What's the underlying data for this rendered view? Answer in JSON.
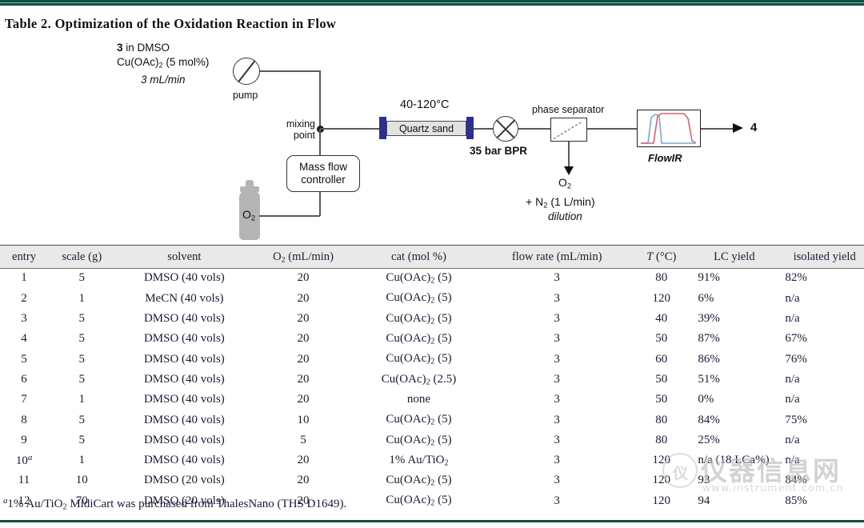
{
  "page": {
    "title": "Table 2. Optimization of the Oxidation Reaction in Flow",
    "accent_color": "#0b4f3f",
    "footnote": "1% Au/TiO2 MidiCart was purchased from ThalesNano (THS D1649).",
    "footnote_marker": "a"
  },
  "scheme": {
    "feed_line1_bold": "3",
    "feed_line1_rest": " in DMSO",
    "feed_line2": "Cu(OAc)2 (5 mol%)",
    "feed_flow": "3 mL/min",
    "pump_label": "pump",
    "mixing_point_label_1": "mixing",
    "mixing_point_label_2": "point",
    "mfc_line1": "Mass flow",
    "mfc_line2": "controller",
    "cylinder_label": "O2",
    "reactor_temp": "40-120°C",
    "reactor_label": "Quartz sand",
    "bpr_label": "35 bar BPR",
    "separator_label": "phase separator",
    "vent_o2": "O2",
    "vent_n2": "+ N2 (1 L/min)",
    "vent_dilution": "dilution",
    "detector_label": "FlowIR",
    "product_label": "4",
    "trace_color_red": "#d9636d",
    "trace_color_blue": "#7aa6cf",
    "reactor_cap_color": "#2c2f8f"
  },
  "table": {
    "headers": [
      "entry",
      "scale (g)",
      "solvent",
      "O2 (mL/min)",
      "cat (mol %)",
      "flow rate (mL/min)",
      "T (°C)",
      "LC yield",
      "isolated yield"
    ],
    "rows": [
      {
        "entry": "1",
        "footnote": "",
        "scale": "5",
        "solvent": "DMSO (40 vols)",
        "o2": "20",
        "cat": "Cu(OAc)2 (5)",
        "flow": "3",
        "temp": "80",
        "lc": "91%",
        "iso": "82%"
      },
      {
        "entry": "2",
        "footnote": "",
        "scale": "1",
        "solvent": "MeCN (40 vols)",
        "o2": "20",
        "cat": "Cu(OAc)2 (5)",
        "flow": "3",
        "temp": "120",
        "lc": "6%",
        "iso": "n/a"
      },
      {
        "entry": "3",
        "footnote": "",
        "scale": "5",
        "solvent": "DMSO (40 vols)",
        "o2": "20",
        "cat": "Cu(OAc)2 (5)",
        "flow": "3",
        "temp": "40",
        "lc": "39%",
        "iso": "n/a"
      },
      {
        "entry": "4",
        "footnote": "",
        "scale": "5",
        "solvent": "DMSO (40 vols)",
        "o2": "20",
        "cat": "Cu(OAc)2 (5)",
        "flow": "3",
        "temp": "50",
        "lc": "87%",
        "iso": "67%"
      },
      {
        "entry": "5",
        "footnote": "",
        "scale": "5",
        "solvent": "DMSO (40 vols)",
        "o2": "20",
        "cat": "Cu(OAc)2 (5)",
        "flow": "3",
        "temp": "60",
        "lc": "86%",
        "iso": "76%"
      },
      {
        "entry": "6",
        "footnote": "",
        "scale": "5",
        "solvent": "DMSO (40 vols)",
        "o2": "20",
        "cat": "Cu(OAc)2 (2.5)",
        "flow": "3",
        "temp": "50",
        "lc": "51%",
        "iso": "n/a"
      },
      {
        "entry": "7",
        "footnote": "",
        "scale": "1",
        "solvent": "DMSO (40 vols)",
        "o2": "20",
        "cat": "none",
        "flow": "3",
        "temp": "50",
        "lc": "0%",
        "iso": "n/a"
      },
      {
        "entry": "8",
        "footnote": "",
        "scale": "5",
        "solvent": "DMSO (40 vols)",
        "o2": "10",
        "cat": "Cu(OAc)2 (5)",
        "flow": "3",
        "temp": "80",
        "lc": "84%",
        "iso": "75%"
      },
      {
        "entry": "9",
        "footnote": "",
        "scale": "5",
        "solvent": "DMSO (40 vols)",
        "o2": "5",
        "cat": "Cu(OAc)2 (5)",
        "flow": "3",
        "temp": "80",
        "lc": "25%",
        "iso": "n/a"
      },
      {
        "entry": "10",
        "footnote": "a",
        "scale": "1",
        "solvent": "DMSO (40 vols)",
        "o2": "20",
        "cat": "1% Au/TiO2",
        "flow": "3",
        "temp": "120",
        "lc": "n/a (18 LCa%)",
        "iso": "n/a"
      },
      {
        "entry": "11",
        "footnote": "",
        "scale": "10",
        "solvent": "DMSO (20 vols)",
        "o2": "20",
        "cat": "Cu(OAc)2 (5)",
        "flow": "3",
        "temp": "120",
        "lc": "93",
        "iso": "84%"
      },
      {
        "entry": "12",
        "footnote": "",
        "scale": "70",
        "solvent": "DMSO (20 vols)",
        "o2": "20",
        "cat": "Cu(OAc)2 (5)",
        "flow": "3",
        "temp": "120",
        "lc": "94",
        "iso": "85%"
      }
    ]
  },
  "watermark": {
    "text": "仪器信息网",
    "url": "www.instrument.com.cn",
    "logo_glyph": "仪"
  }
}
